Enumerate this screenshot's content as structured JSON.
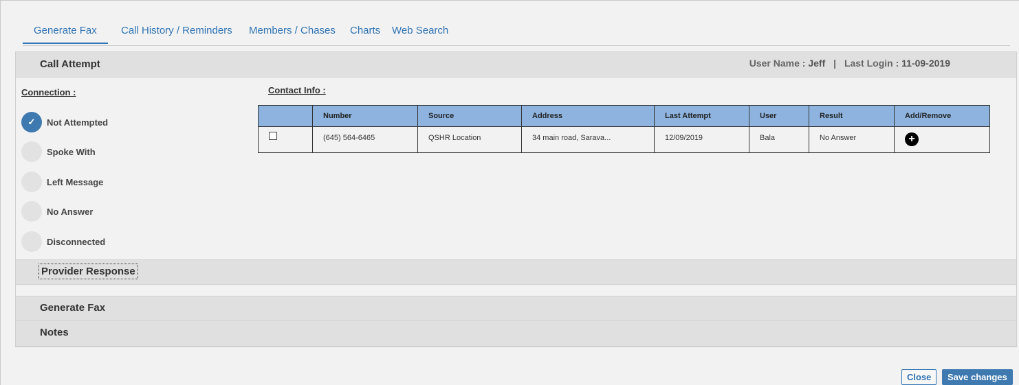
{
  "tabs": [
    "Generate Fax",
    "Call History / Reminders",
    "Members / Chases",
    "Charts",
    "Web Search"
  ],
  "call_attempt": {
    "title": "Call Attempt",
    "user_name_label": "User Name :",
    "user_name": "Jeff",
    "separator": "|",
    "last_login_label": "Last Login :",
    "last_login": "11-09-2019"
  },
  "connection": {
    "label": "Connection :",
    "options": [
      "Not Attempted",
      "Spoke With",
      "Left Message",
      "No Answer",
      "Disconnected"
    ],
    "selected": "Not Attempted"
  },
  "contact_info": {
    "label": "Contact Info :",
    "columns": [
      "",
      "Number",
      "Source",
      "Address",
      "Last Attempt",
      "User",
      "Result",
      "Add/Remove"
    ],
    "rows": [
      {
        "number": "(645) 564-6465",
        "source": "QSHR Location",
        "address": "34 main road, Sarava...",
        "last_attempt": "12/09/2019",
        "user": "Bala",
        "result": "No Answer"
      }
    ]
  },
  "sections": [
    "Provider Response",
    "Generate Fax",
    "Notes"
  ],
  "icons": {
    "check": "check-icon",
    "add": "plus-circle-icon"
  },
  "colors": {
    "accent": "#2f73b5",
    "table_header": "#8eb3df",
    "radio_checked": "#3e79b0"
  },
  "buttons": {
    "close": "Close",
    "save": "Save changes"
  }
}
